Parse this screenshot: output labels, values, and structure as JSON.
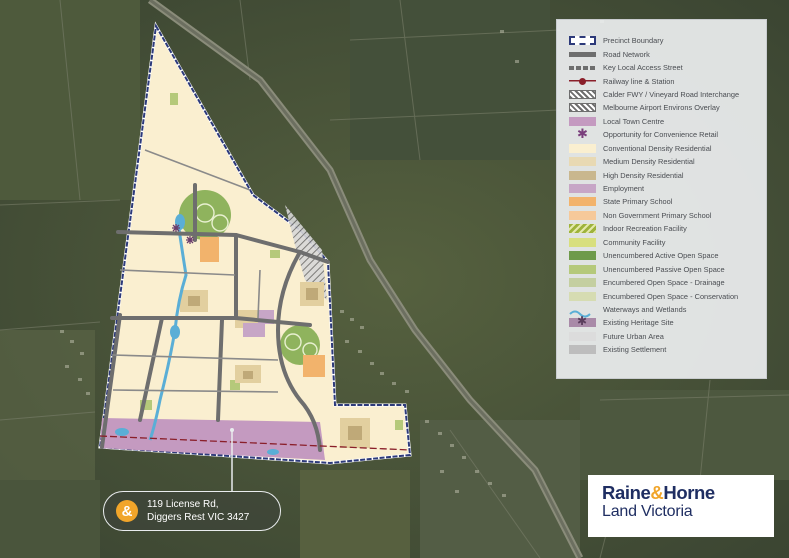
{
  "legend": {
    "items": [
      {
        "label": "Precinct Boundary",
        "symbol": "precinct-boundary",
        "color": "#2d3a7a"
      },
      {
        "label": "Road Network",
        "symbol": "road-network",
        "color": "#6e6e6e"
      },
      {
        "label": "Key Local Access Street",
        "symbol": "key-local-access-street",
        "color": "#6e6e6e"
      },
      {
        "label": "Railway line & Station",
        "symbol": "railway-line-station",
        "color": "#8a1f2a"
      },
      {
        "label": "Calder FWY / Vineyard Road Interchange",
        "symbol": "hatched-interchange",
        "color": "#6e6e6e"
      },
      {
        "label": "Melbourne Airport Environs Overlay",
        "symbol": "hatched-overlay",
        "color": "#6e6e6e"
      },
      {
        "label": "Local Town Centre",
        "symbol": "swatch",
        "color": "#c49ac0"
      },
      {
        "label": "Opportunity for Convenience Retail",
        "symbol": "asterisk",
        "color": "#7a3f7c"
      },
      {
        "label": "Conventional Density Residential",
        "symbol": "swatch",
        "color": "#faefd0"
      },
      {
        "label": "Medium Density Residential",
        "symbol": "swatch",
        "color": "#e8d9b3"
      },
      {
        "label": "High Density Residential",
        "symbol": "swatch",
        "color": "#c9b78e"
      },
      {
        "label": "Employment",
        "symbol": "swatch",
        "color": "#c7a6c6"
      },
      {
        "label": "State Primary School",
        "symbol": "swatch",
        "color": "#f2b36c"
      },
      {
        "label": "Non Government Primary School",
        "symbol": "swatch",
        "color": "#f6c99a"
      },
      {
        "label": "Indoor Recreation Facility",
        "symbol": "striped",
        "color": "#9eb33b"
      },
      {
        "label": "Community Facility",
        "symbol": "swatch",
        "color": "#d8df7e"
      },
      {
        "label": "Unencumbered Active Open Space",
        "symbol": "swatch",
        "color": "#6e9a4a"
      },
      {
        "label": "Unencumbered Passive Open Space",
        "symbol": "swatch",
        "color": "#b5c97a"
      },
      {
        "label": "Encumbered Open Space - Drainage",
        "symbol": "swatch",
        "color": "#c4cfa0"
      },
      {
        "label": "Encumbered Open Space - Conservation",
        "symbol": "swatch",
        "color": "#d6dcb2"
      },
      {
        "label": "Waterways and Wetlands",
        "symbol": "waterway",
        "color": "#5aaed6"
      },
      {
        "label": "Existing Heritage Site",
        "symbol": "heritage",
        "color": "#7a5a7c"
      },
      {
        "label": "Future Urban Area",
        "symbol": "swatch",
        "color": "#dcdcdc"
      },
      {
        "label": "Existing Settlement",
        "symbol": "swatch",
        "color": "#bdbdbd"
      }
    ]
  },
  "address": {
    "icon": "ampersand-icon",
    "icon_glyph": "&",
    "line1": "119 License Rd,",
    "line2": "Diggers Rest VIC 3427"
  },
  "brand": {
    "part1": "Raine",
    "amp": "&",
    "part2": "Horne",
    "subtitle": "Land Victoria",
    "color": "#1f2e62",
    "accent": "#f1a52a"
  },
  "colors": {
    "aerial": "#4b5740",
    "residential": "#faefd0",
    "road": "#6e6e6e",
    "boundary": "#2d3a7a",
    "town_centre": "#c49ac0",
    "waterway": "#5aaed6"
  }
}
